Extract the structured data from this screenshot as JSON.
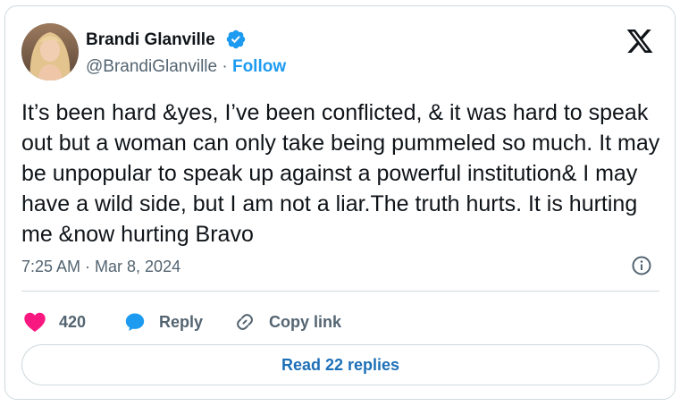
{
  "author": {
    "display_name": "Brandi Glanville",
    "handle": "@BrandiGlanville",
    "separator": " · ",
    "follow_label": "Follow",
    "verified": true
  },
  "tweet": {
    "text": "It’s been hard &yes, I’ve been conflicted, & it was hard to speak out but a woman can only take being pummeled so much. It may be unpopular to speak up against a powerful institution& I may have a wild side, but I am not a liar.The truth hurts. It is hurting me &now hurting Bravo",
    "timestamp": "7:25 AM · Mar 8, 2024"
  },
  "actions": {
    "like_count": "420",
    "reply_label": "Reply",
    "copy_link_label": "Copy link"
  },
  "footer": {
    "read_replies_label": "Read 22 replies"
  },
  "icons": {
    "brand": "x-logo-icon",
    "verified": "verified-badge-icon",
    "info": "info-icon",
    "like": "heart-icon",
    "reply": "speech-bubble-icon",
    "copy": "link-icon"
  },
  "colors": {
    "accent": "#1d9bf0",
    "like": "#f91880",
    "text": "#0f1419",
    "muted": "#536471",
    "border": "#cfd9de"
  }
}
